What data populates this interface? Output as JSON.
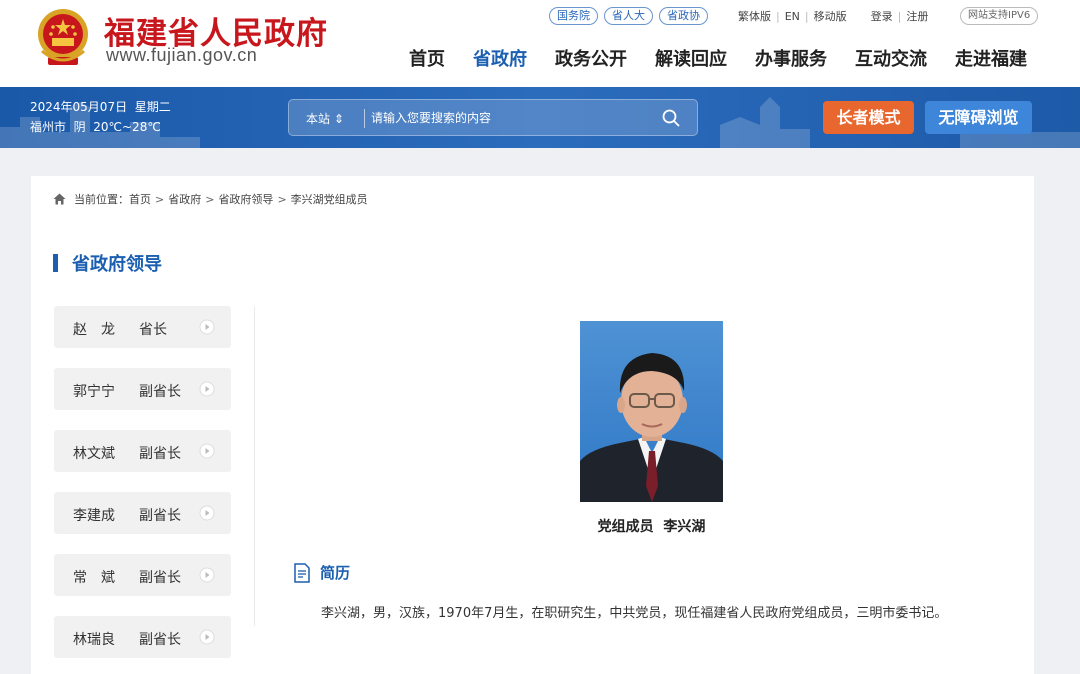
{
  "header": {
    "site_title": "福建省人民政府",
    "site_url": "www.fujian.gov.cn",
    "pills": [
      "国务院",
      "省人大",
      "省政协"
    ],
    "top_links": {
      "traditional": "繁体版",
      "english": "EN",
      "mobile": "移动版",
      "login": "登录",
      "register": "注册"
    },
    "ipv6": "网站支持IPV6",
    "nav": [
      "首页",
      "省政府",
      "政务公开",
      "解读回应",
      "办事服务",
      "互动交流",
      "走进福建"
    ],
    "nav_active": "省政府"
  },
  "band": {
    "date": "2024年05月07日  星期二",
    "weather": "福州市  阴  20℃~28℃",
    "search": {
      "scope": "本站",
      "placeholder": "请输入您要搜索的内容"
    },
    "elder_mode": "长者模式",
    "accessible": "无障碍浏览"
  },
  "breadcrumb": {
    "label": "当前位置：",
    "items": [
      "首页",
      "省政府",
      "省政府领导",
      "李兴湖党组成员"
    ]
  },
  "section_title": "省政府领导",
  "leaders": [
    {
      "name": "赵　龙",
      "title": "省长"
    },
    {
      "name": "郭宁宁",
      "title": "副省长"
    },
    {
      "name": "林文斌",
      "title": "副省长"
    },
    {
      "name": "李建成",
      "title": "副省长"
    },
    {
      "name": "常　斌",
      "title": "副省长"
    },
    {
      "name": "林瑞良",
      "title": "副省长"
    }
  ],
  "profile": {
    "caption": "党组成员  李兴湖",
    "bio_heading": "简历",
    "bio": "李兴湖，男，汉族，1970年7月生，在职研究生，中共党员，现任福建省人民政府党组成员，三明市委书记。"
  },
  "colors": {
    "brand_red": "#c8161d",
    "brand_blue": "#1b5fb0",
    "elder_orange": "#e8672f"
  }
}
